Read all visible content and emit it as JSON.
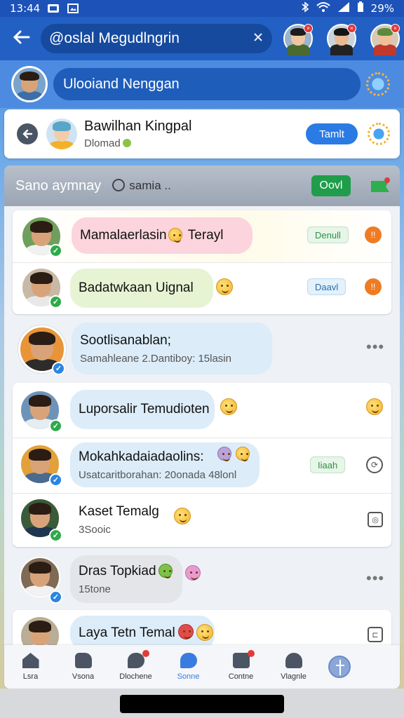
{
  "status_bar": {
    "time": "13:44",
    "battery": "29%"
  },
  "top_bar": {
    "search_query": "@oslal Megudlngrin"
  },
  "profile_bar": {
    "title": "Ulooiand Nenggan"
  },
  "chat_header": {
    "name": "Bawilhan Kingpal",
    "status": "Dlomad",
    "action_label": "Tamlt"
  },
  "group_bar": {
    "title": "Sano aymnay",
    "mention": "samia ..",
    "button_label": "Oovl"
  },
  "messages": [
    {
      "title": "Mamalaerlasin",
      "title2": "Terayl",
      "tag": "Denull",
      "bubble_color": "#fbd4dd"
    },
    {
      "title": "Badatwkaan Uignal",
      "tag": "Daavl",
      "bubble_color": "#e6f4d3"
    },
    {
      "title": "Sootlisanablan;",
      "subtitle": "Samahleane 2.Dantiboy: 15lasin",
      "bubble_color": "#dcecf8"
    },
    {
      "title": "Luporsalir Temudioten",
      "bubble_color": "#dcecf8"
    },
    {
      "title": "Mokahkadaiadaolins:",
      "subtitle": "Usatcaritborahan: 20onada 48lonl",
      "tag": "Iiaah",
      "bubble_color": "#dcecf8"
    },
    {
      "title": "Kaset Temalg",
      "subtitle": "3Sooic",
      "bubble_color": "#ffffff"
    },
    {
      "title": "Dras Topkiad",
      "subtitle": "15tone",
      "bubble_color": "#e3e5e8"
    },
    {
      "title": "Laya Tetn Temal",
      "bubble_color": "#dcecf8"
    }
  ],
  "bottom_nav": {
    "items": [
      {
        "label": "Lsra"
      },
      {
        "label": "Vsona"
      },
      {
        "label": "Dlochene"
      },
      {
        "label": "Sonne"
      },
      {
        "label": "Contne"
      },
      {
        "label": "Vlagnle"
      }
    ]
  },
  "colors": {
    "primary": "#2360c4",
    "accent_green": "#1f9d4b",
    "verified_blue": "#2a86e0"
  }
}
